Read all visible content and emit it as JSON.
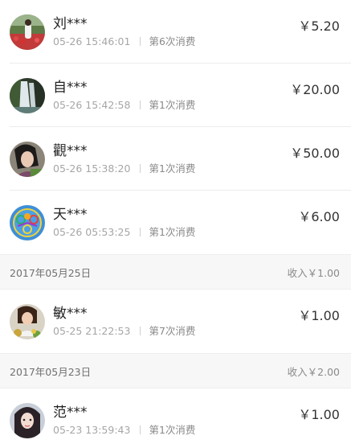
{
  "records": [
    {
      "name": "刘***",
      "time": "05-26 15:46:01",
      "count": "第6次消费",
      "amount": "￥5.20",
      "avatar": "flower-field-avatar"
    },
    {
      "name": "自***",
      "time": "05-26 15:42:58",
      "count": "第1次消费",
      "amount": "￥20.00",
      "avatar": "waterfall-avatar"
    },
    {
      "name": "觀***",
      "time": "05-26 15:38:20",
      "count": "第1次消费",
      "amount": "￥50.00",
      "avatar": "woman-portrait-avatar"
    },
    {
      "name": "天***",
      "time": "05-26 05:53:25",
      "count": "第1次消费",
      "amount": "￥6.00",
      "avatar": "emblem-avatar"
    }
  ],
  "group_2017_05_25": {
    "date": "2017年05月25日",
    "income": "收入￥1.00",
    "records": [
      {
        "name": "敏***",
        "time": "05-25 21:22:53",
        "count": "第7次消费",
        "amount": "￥1.00",
        "avatar": "woman-flowers-avatar"
      }
    ]
  },
  "group_2017_05_23": {
    "date": "2017年05月23日",
    "income": "收入￥2.00",
    "records": [
      {
        "name": "范***",
        "time": "05-23 13:59:43",
        "count": "第1次消费",
        "amount": "￥1.00",
        "avatar": "girl-portrait-avatar"
      }
    ]
  },
  "colors": {
    "divider": "#ececec",
    "header_bg": "#f7f7f7",
    "meta_text": "#a6a6a6"
  }
}
